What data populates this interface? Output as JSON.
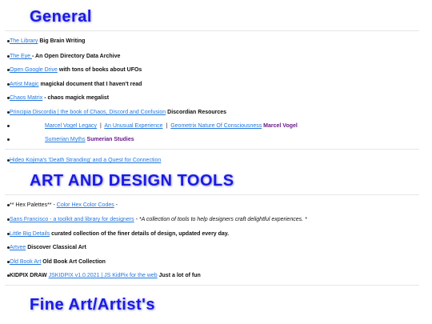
{
  "sections": {
    "general_title": "General",
    "art_title": "ART AND DESIGN TOOLS",
    "fine_art_title": "Fine Art/Artist's"
  },
  "general": {
    "item1": {
      "link": "The Library",
      "text": "Big Brain Writing"
    },
    "item2": {
      "link": "The Eye ",
      "text": "- An Open Directory Data Archive"
    },
    "item3": {
      "link": "Open Google Drive",
      "text": "with tons of books about UFOs"
    },
    "item4": {
      "link": "Artist Magic",
      "text": "magickal document that I haven't read"
    },
    "item5": {
      "link": "Chaos Matrix",
      "text": "- chaos magick megalist"
    },
    "item6": {
      "link": "Principia Discordia | the book of Chaos, Discord and Confusion",
      "text": "Discordian Resources"
    },
    "item7": {
      "link1": "Marcel Vogel Legacy",
      "sep1": "|",
      "link2": "An Unusual Experience",
      "sep2": "|",
      "link3": "Geometrix Nature Of Consciousness",
      "text": "Marcel Vogel"
    },
    "item8": {
      "link": "Sumerian Myths",
      "text": "Sumerian Studies"
    },
    "item9": {
      "link": "Hideo Kojima's 'Death Stranding' and a Quest for Connection"
    }
  },
  "art": {
    "item1": {
      "prefix": "** Hex Palettes** -",
      "link": "Color Hex Color Codes",
      "suffix": "-"
    },
    "item2": {
      "link": "Sans Francisco - a toolkit and library for designers",
      "text": "- *A collection of tools to help designers craft delightful experiences. *"
    },
    "item3": {
      "link": "Little Big Details",
      "text": "curated collection of the finer details of design, updated every day."
    },
    "item4": {
      "link": "Artvee",
      "text": "Discover Classical Art"
    },
    "item5": {
      "link": "Old Book Art",
      "text": "Old Book Art Collection"
    },
    "item6": {
      "prefix": "KIDPIX DRAW",
      "link": "JSKIDPIX v1.0.2021 | JS KidPix for the web",
      "text": "Just a lot of fun"
    }
  },
  "colors": {
    "title": "#1a1ae6",
    "link": "#2277dd",
    "accent_purple": "#6a1b8a"
  }
}
